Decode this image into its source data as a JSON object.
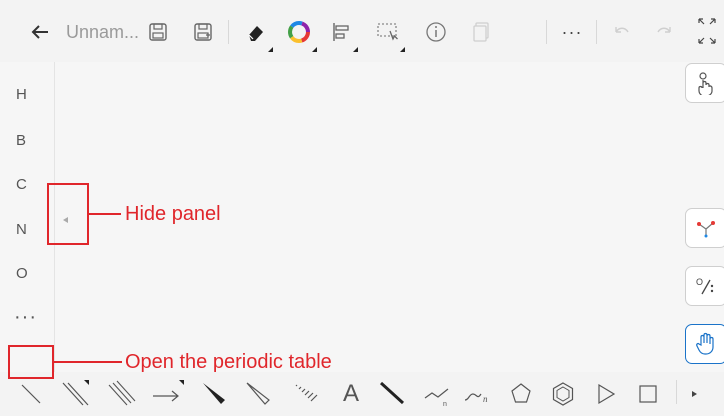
{
  "toolbar": {
    "back_icon": "arrow-left-icon",
    "title": "Unnam...",
    "more_label": "···",
    "colors": {
      "ring": [
        "#e53935",
        "#fbc02d",
        "#43a047",
        "#1e88e5",
        "#8e24aa"
      ]
    }
  },
  "left_panel": {
    "elements": [
      "H",
      "B",
      "C",
      "N",
      "O"
    ],
    "more_label": "···"
  },
  "annotations": {
    "hide_panel": "Hide panel",
    "periodic_table": "Open the periodic table",
    "color": "#e0262b"
  },
  "bottom_bar": {
    "text_tool_label": "A"
  },
  "colors": {
    "active_accent": "#1a73c9",
    "toolbar_bg": "#f3f3f3"
  }
}
